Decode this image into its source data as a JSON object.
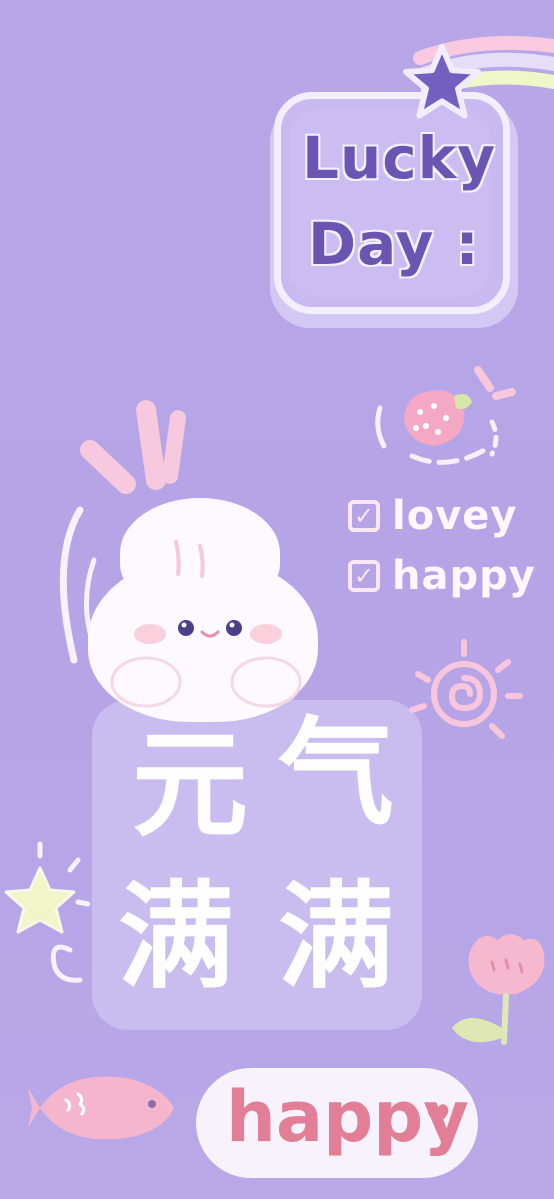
{
  "card": {
    "line1": "Lucky",
    "line2": "Day :"
  },
  "checklist": [
    {
      "label": "lovey",
      "checked": true
    },
    {
      "label": "happy",
      "checked": true
    }
  ],
  "main_text": {
    "row1": [
      "元",
      "气"
    ],
    "row2": [
      "满",
      "满"
    ]
  },
  "footer": {
    "label": "happy"
  },
  "colors": {
    "background": "#b7a6e6",
    "card_text": "#6a56b2",
    "pink_text": "#e27e96",
    "white": "#fffefe"
  },
  "icons": [
    "star-icon",
    "strawberry-icon",
    "bunny-illustration",
    "sun-swirl-icon",
    "sparkle-star-icon",
    "fish-icon",
    "flower-icon",
    "heart-icon"
  ]
}
